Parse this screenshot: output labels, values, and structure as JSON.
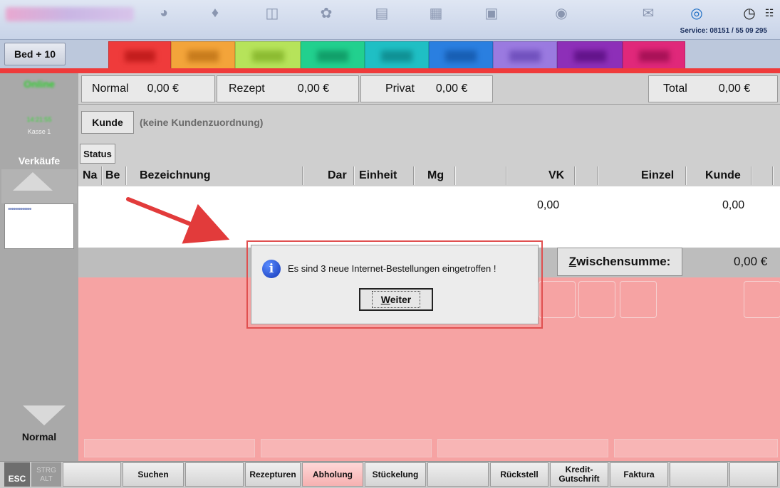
{
  "topbar": {
    "service_label": "Service: 08151 / 55 09 295",
    "icons": [
      "mortar-icon",
      "handshake-icon",
      "bag-icon",
      "bear-icon",
      "printer-icon",
      "books-icon",
      "scanner-icon",
      "pill-icon",
      "mail-icon",
      "at-icon",
      "clock-icon"
    ]
  },
  "tabs": {
    "bed_label": "Bed + 10",
    "colors": [
      "#ef3b3b",
      "#f3a43a",
      "#b6e35a",
      "#22d08e",
      "#1fbfc4",
      "#2a7fe0",
      "#9a7ae0",
      "#8d2fb8",
      "#e0287a"
    ]
  },
  "sidebar": {
    "online": "Online",
    "time": "14:21:55",
    "kasse": "Kasse 1",
    "sales_label": "Verkäufe",
    "mode_label": "Normal"
  },
  "totals": {
    "normal_label": "Normal",
    "normal_value": "0,00 €",
    "rezept_label": "Rezept",
    "rezept_value": "0,00 €",
    "privat_label": "Privat",
    "privat_value": "0,00 €",
    "total_label": "Total",
    "total_value": "0,00 €"
  },
  "customer": {
    "button_label": "Kunde",
    "assignment_text": "(keine Kundenzuordnung)"
  },
  "status_button": "Status",
  "columns": [
    "Na",
    "Be",
    "Bezeichnung",
    "Dar",
    "Einheit",
    "Mg",
    "VK",
    "Einzel",
    "Kunde"
  ],
  "row_values": {
    "vk": "0,00",
    "kunde": "0,00"
  },
  "subtotal": {
    "label_underlined": "Z",
    "label_rest": "wischensumme:",
    "value": "0,00 €"
  },
  "dialog": {
    "message": "Es sind 3 neue Internet-Bestellungen eingetroffen !",
    "button_underlined": "W",
    "button_rest": "eiter"
  },
  "function_keys": {
    "esc": "ESC",
    "strg": "STRG",
    "alt": "ALT",
    "keys": [
      "",
      "Suchen",
      "",
      "Rezepturen",
      "Abholung",
      "Stückelung",
      "",
      "Rückstell",
      "Kredit-\nGutschrift",
      "Faktura",
      "",
      ""
    ]
  }
}
